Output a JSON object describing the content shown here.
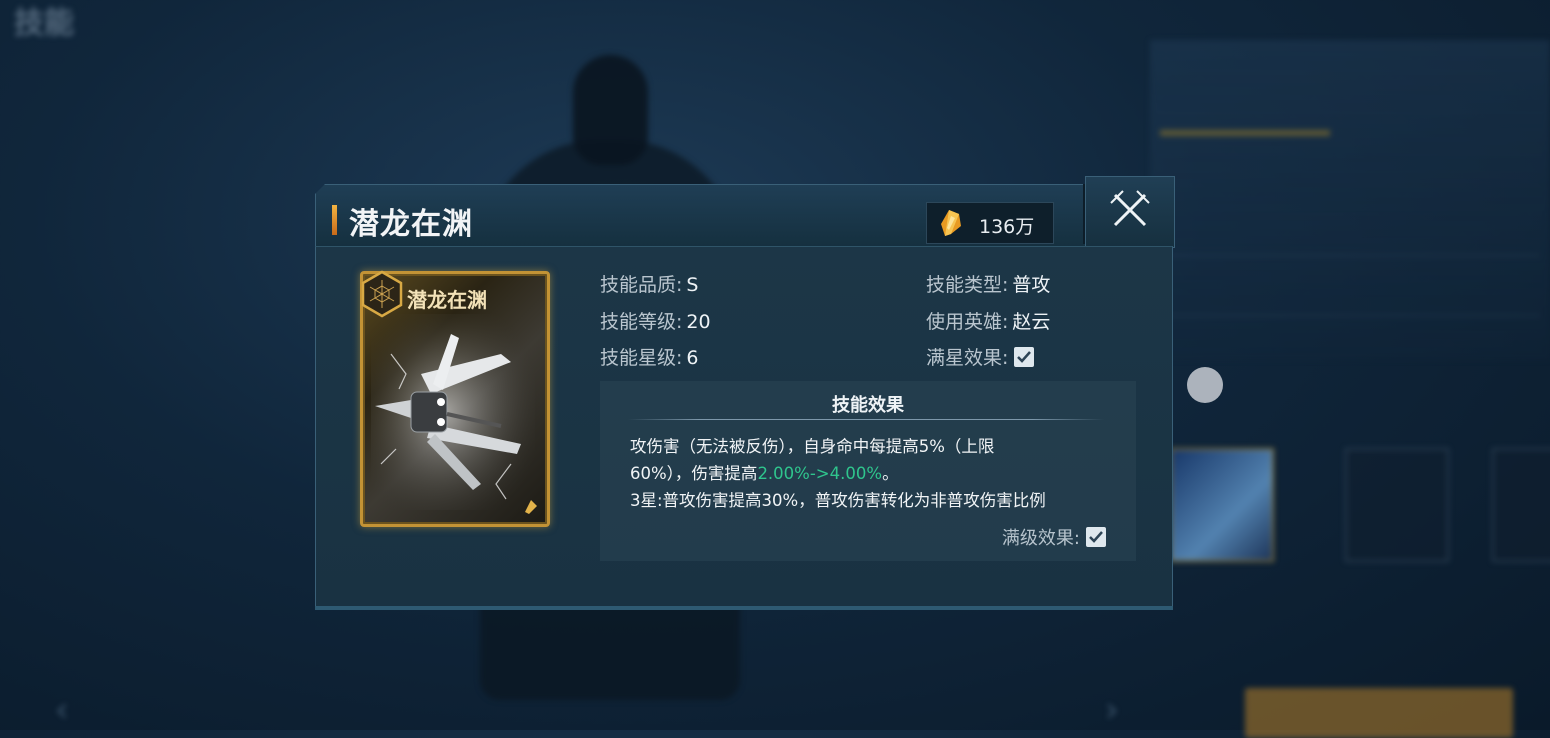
{
  "background": {
    "page_title": "技能"
  },
  "dialog": {
    "title": "潜龙在渊",
    "currency": {
      "icon": "gold-crystal-icon",
      "value": "136万"
    },
    "close_icon": "crossed-swords-close-icon"
  },
  "card": {
    "name": "潜龙在渊",
    "emblem_icon": "hexagon-web-icon",
    "art_icon": "spear-weapon-icon"
  },
  "stats": {
    "quality_label": "技能品质:",
    "quality_value": "S",
    "level_label": "技能等级:",
    "level_value": "20",
    "star_label": "技能星级:",
    "star_value": "6",
    "type_label": "技能类型:",
    "type_value": "普攻",
    "hero_label": "使用英雄:",
    "hero_value": "赵云",
    "full_star_label": "满星效果:",
    "full_star_checked": true
  },
  "effect": {
    "title": "技能效果",
    "line1": "攻伤害（无法被反伤），自身命中每提高5%（上限",
    "line2_prefix": "60%），伤害提高",
    "line2_highlight": "2.00%->4.00%",
    "line2_suffix": "。",
    "line3": "3星:普攻伤害提高30%，普攻伤害转化为非普攻伤害比例",
    "full_level_label": "满级效果:",
    "full_level_checked": true
  },
  "colors": {
    "highlight_green": "#2fc58d",
    "gold_border": "#c39335",
    "title_accent": "#f3b442"
  }
}
